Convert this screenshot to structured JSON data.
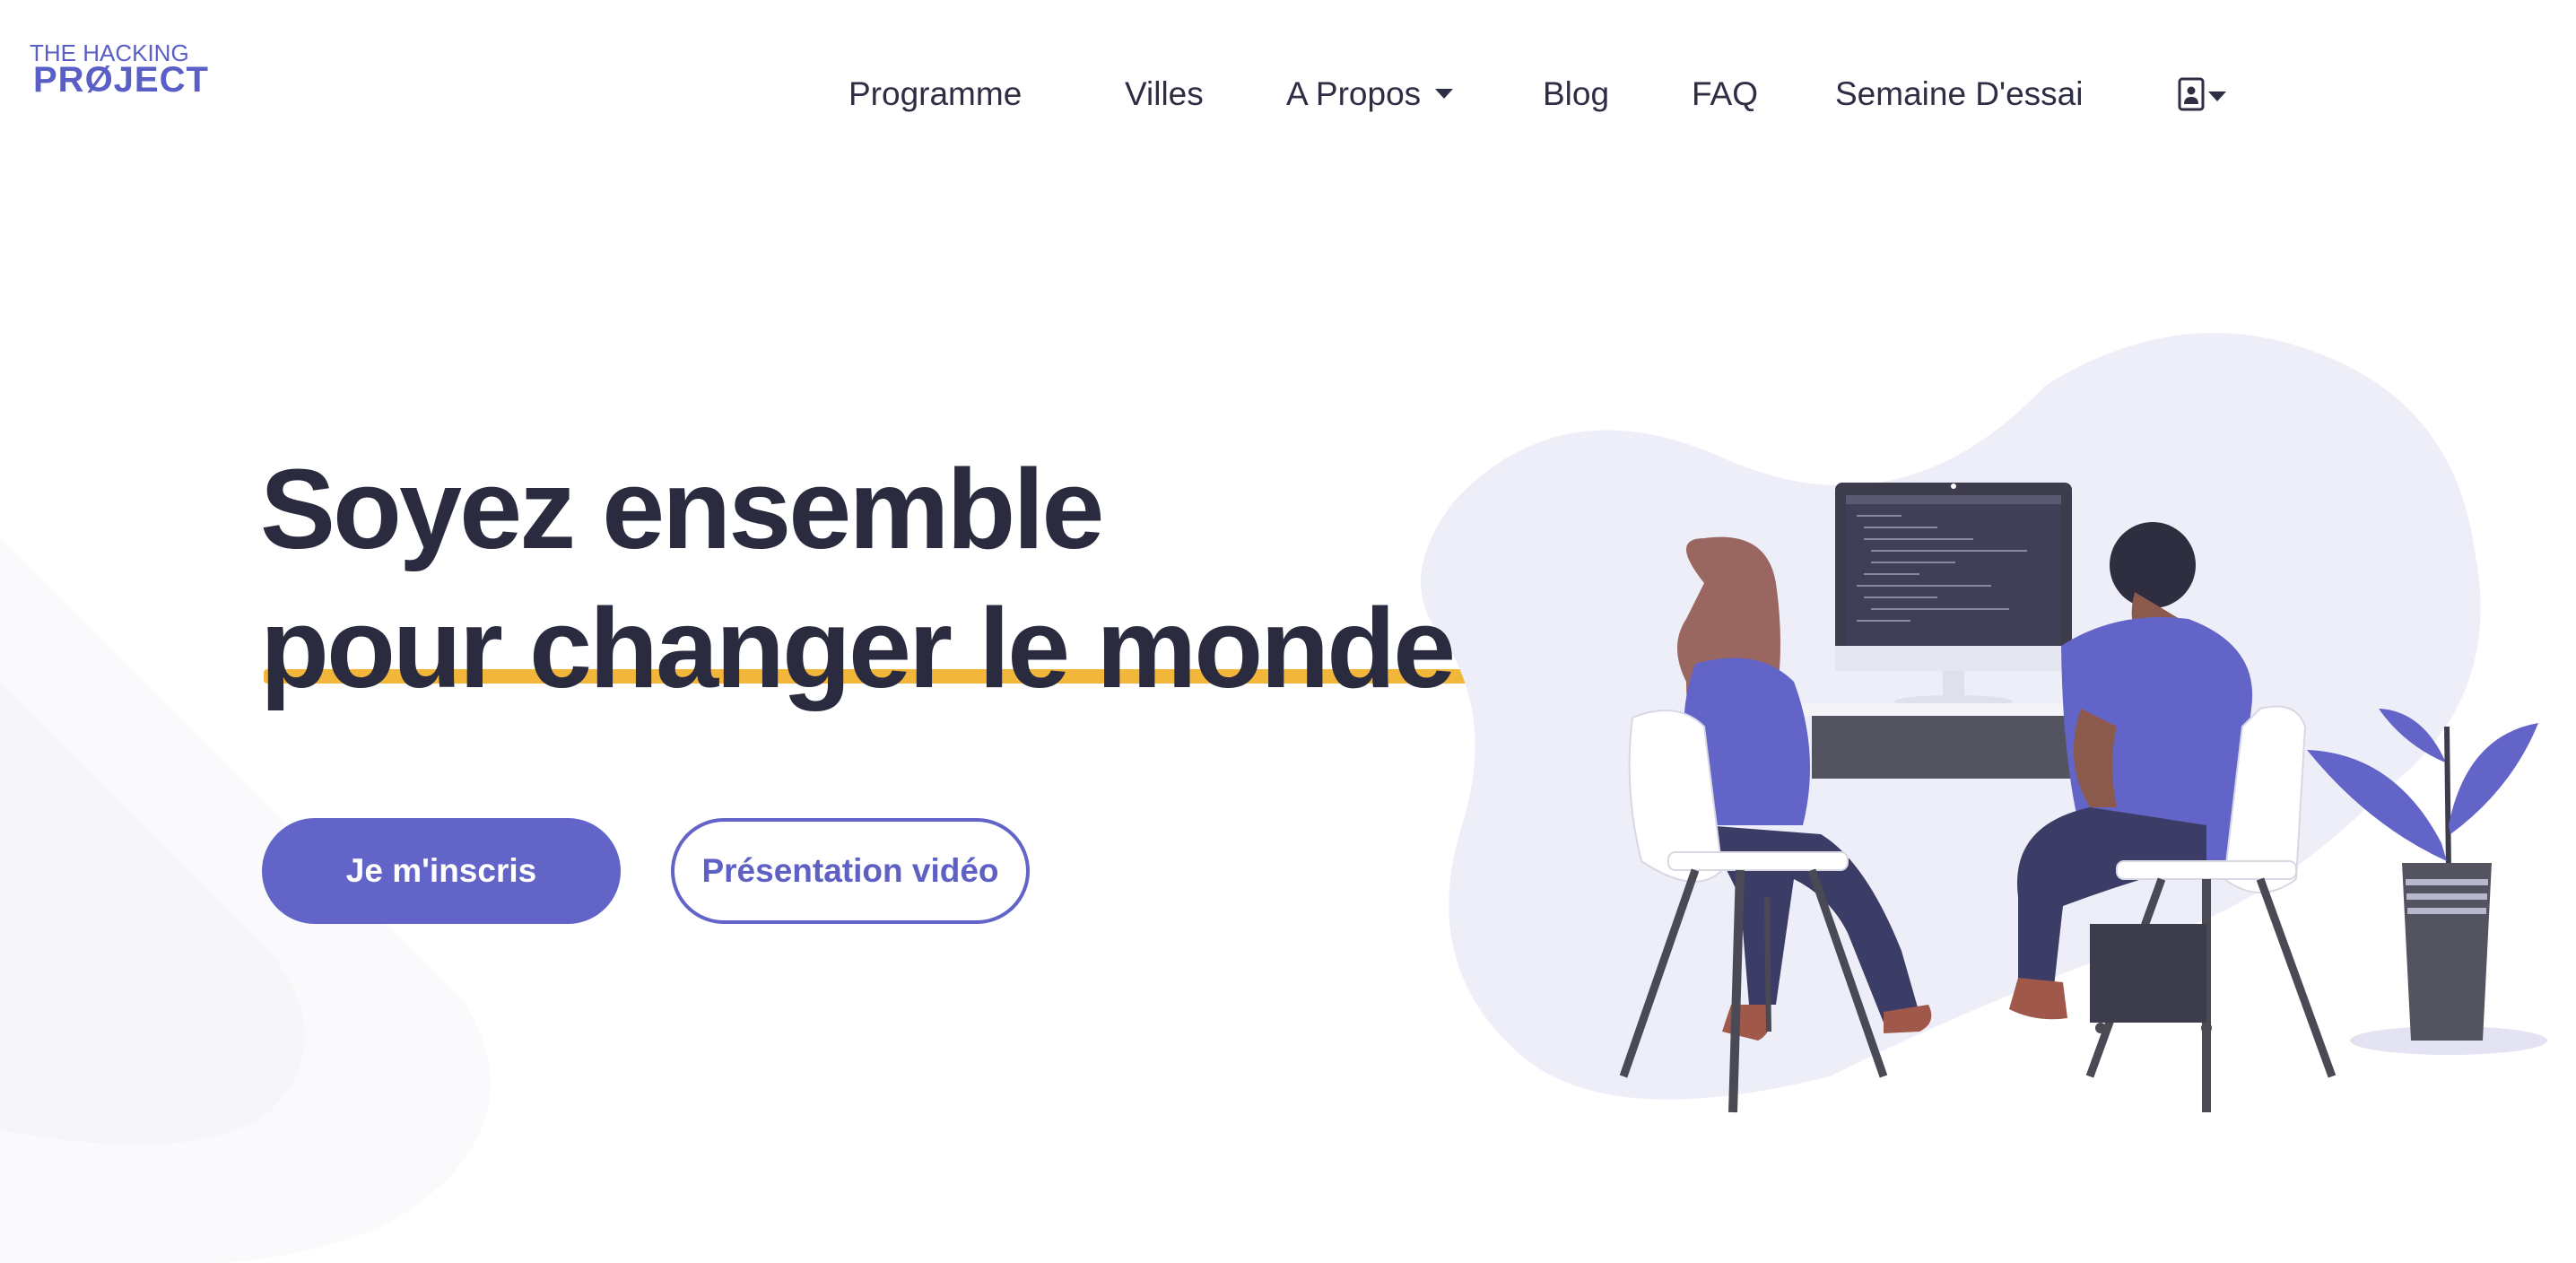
{
  "logo": {
    "line1": "THE HACKING",
    "line2": "PRØJECT"
  },
  "nav": {
    "items": [
      {
        "label": "Programme"
      },
      {
        "label": "Villes"
      },
      {
        "label": "A Propos"
      },
      {
        "label": "Blog"
      },
      {
        "label": "FAQ"
      },
      {
        "label": "Semaine D'essai"
      }
    ]
  },
  "hero": {
    "title_line1": "Soyez ensemble",
    "title_line2": "pour changer le monde",
    "primary_button": "Je m'inscris",
    "secondary_button": "Présentation vidéo"
  },
  "colors": {
    "accent": "#6364c7",
    "highlight": "#f2b63b",
    "text": "#2b2b40",
    "blob": "#eeeef9"
  },
  "icons": {
    "profile": "user-badge-icon",
    "dropdown": "caret-down-icon"
  }
}
